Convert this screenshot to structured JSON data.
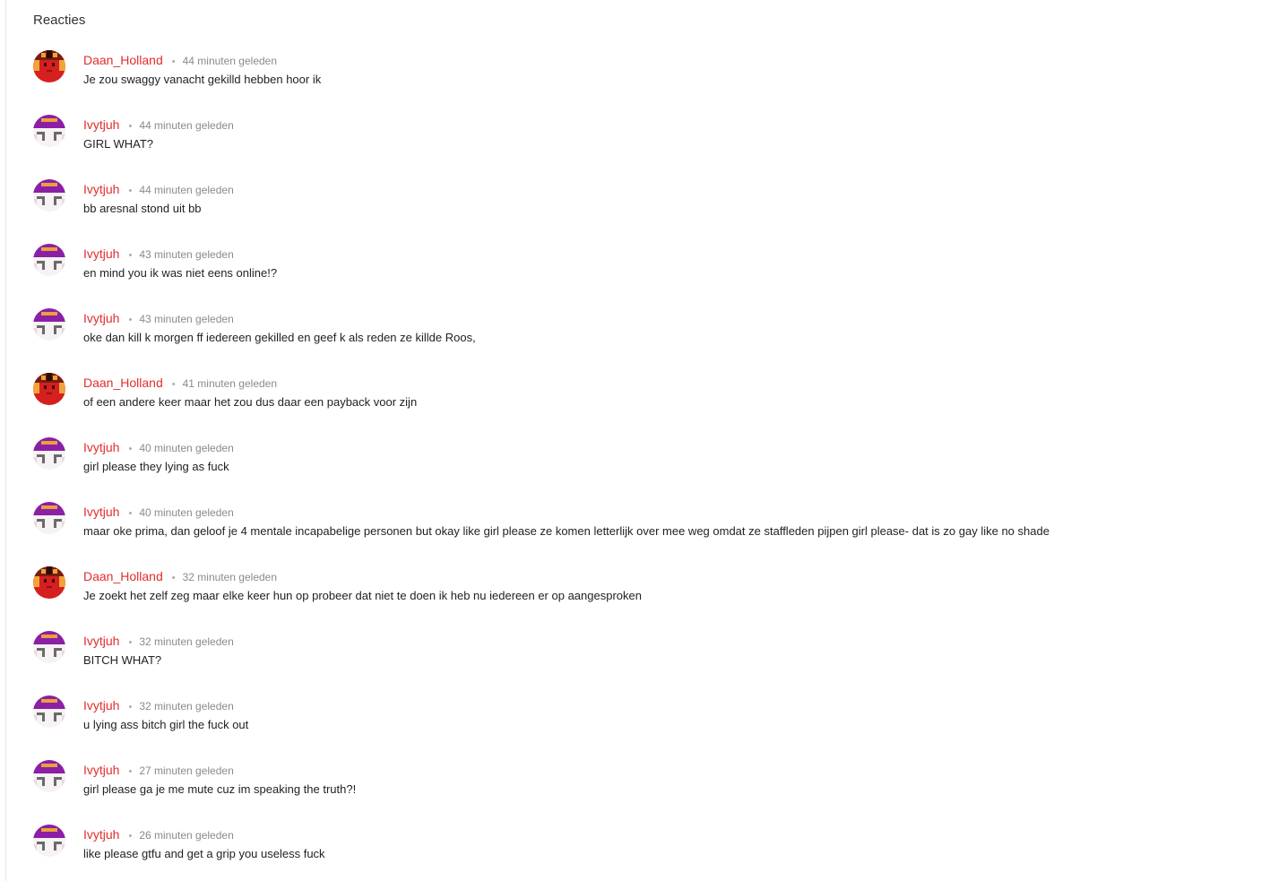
{
  "section": {
    "title": "Reacties"
  },
  "separator": "•",
  "comments": [
    {
      "avatar": "daan",
      "user": "Daan_Holland",
      "time": "44 minuten geleden",
      "text": "Je zou swaggy vanacht gekilld hebben hoor ik"
    },
    {
      "avatar": "ivy",
      "user": "Ivytjuh",
      "time": "44 minuten geleden",
      "text": "GIRL WHAT?"
    },
    {
      "avatar": "ivy",
      "user": "Ivytjuh",
      "time": "44 minuten geleden",
      "text": "bb aresnal stond uit bb"
    },
    {
      "avatar": "ivy",
      "user": "Ivytjuh",
      "time": "43 minuten geleden",
      "text": "en mind you ik was niet eens online!?"
    },
    {
      "avatar": "ivy",
      "user": "Ivytjuh",
      "time": "43 minuten geleden",
      "text": "oke dan kill k morgen ff iedereen gekilled en geef k als reden ze killde Roos,"
    },
    {
      "avatar": "daan",
      "user": "Daan_Holland",
      "time": "41 minuten geleden",
      "text": "of een andere keer maar het zou dus daar een payback voor zijn"
    },
    {
      "avatar": "ivy",
      "user": "Ivytjuh",
      "time": "40 minuten geleden",
      "text": "girl please they lying as fuck"
    },
    {
      "avatar": "ivy",
      "user": "Ivytjuh",
      "time": "40 minuten geleden",
      "text": "maar oke prima, dan geloof je 4 mentale incapabelige personen but okay like girl please ze komen letterlijk over mee weg omdat ze staffleden pijpen girl please- dat is zo gay like no shade"
    },
    {
      "avatar": "daan",
      "user": "Daan_Holland",
      "time": "32 minuten geleden",
      "text": "Je zoekt het zelf zeg maar elke keer hun op probeer dat niet te doen ik heb nu iedereen er op aangesproken"
    },
    {
      "avatar": "ivy",
      "user": "Ivytjuh",
      "time": "32 minuten geleden",
      "text": "BITCH WHAT?"
    },
    {
      "avatar": "ivy",
      "user": "Ivytjuh",
      "time": "32 minuten geleden",
      "text": "u lying ass bitch girl the fuck out"
    },
    {
      "avatar": "ivy",
      "user": "Ivytjuh",
      "time": "27 minuten geleden",
      "text": "girl please ga je me mute cuz im speaking the truth?!"
    },
    {
      "avatar": "ivy",
      "user": "Ivytjuh",
      "time": "26 minuten geleden",
      "text": "like please gtfu and get a grip you useless fuck"
    }
  ]
}
